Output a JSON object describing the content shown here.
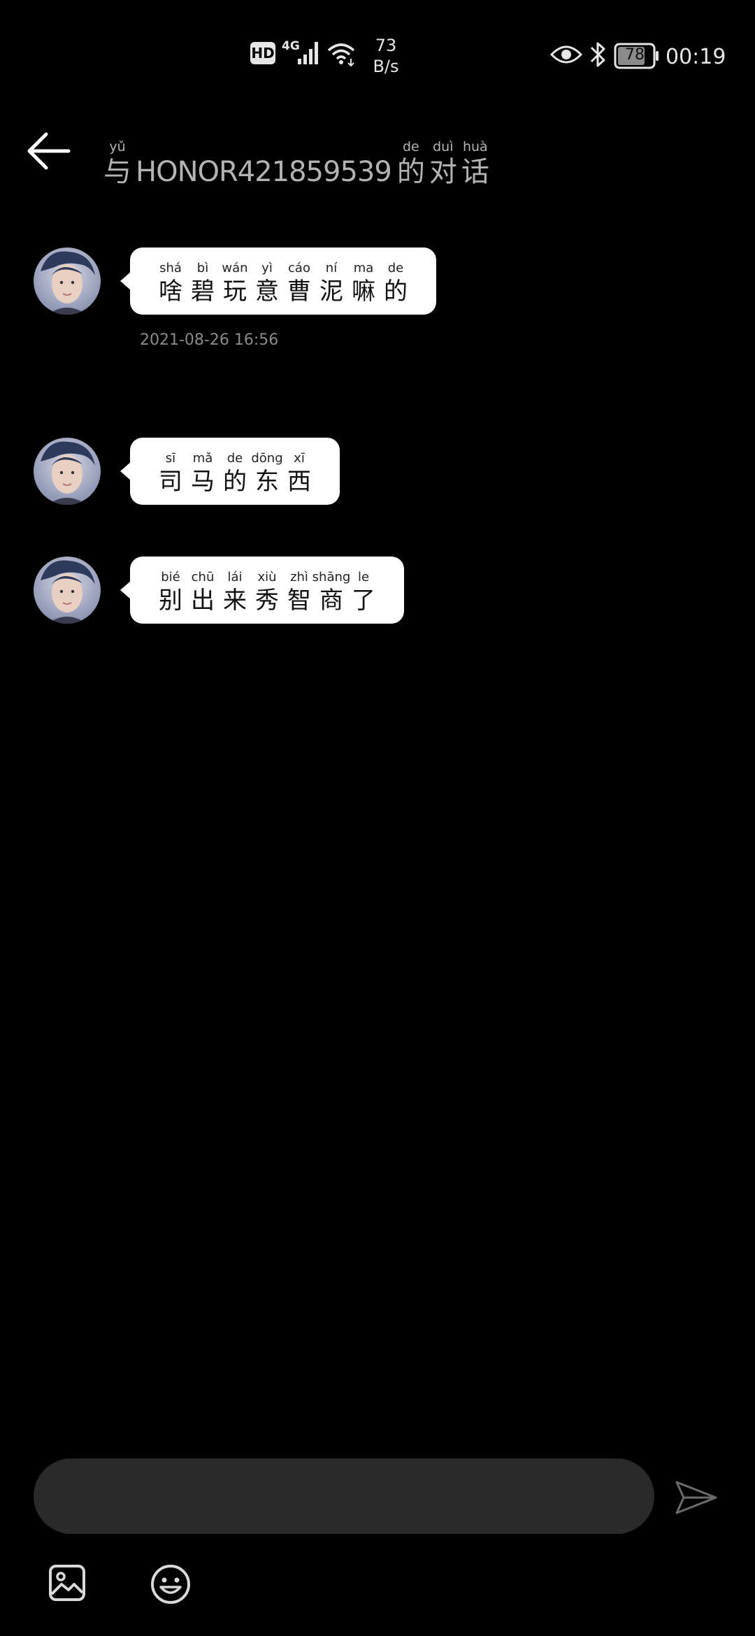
{
  "status_bar": {
    "hd": "HD",
    "network": "4G",
    "speed_value": "73",
    "speed_unit": "B/s",
    "battery": "78",
    "time": "00:19",
    "icons": [
      "signal-icon",
      "wifi-icon",
      "eye-icon",
      "bluetooth-icon",
      "battery-icon"
    ]
  },
  "header": {
    "title_prefix": {
      "py": "yǔ",
      "hz": "与"
    },
    "title_name": "HONOR421859539",
    "title_suffix": [
      {
        "py": "de",
        "hz": "的"
      },
      {
        "py": "duì",
        "hz": "对"
      },
      {
        "py": "huà",
        "hz": "话"
      }
    ]
  },
  "messages": [
    {
      "chars": [
        {
          "py": "shá",
          "hz": "啥"
        },
        {
          "py": "bì",
          "hz": "碧"
        },
        {
          "py": "wán",
          "hz": "玩"
        },
        {
          "py": "yì",
          "hz": "意"
        },
        {
          "py": "cáo",
          "hz": "曹"
        },
        {
          "py": "ní",
          "hz": "泥"
        },
        {
          "py": "ma",
          "hz": "嘛"
        },
        {
          "py": "de",
          "hz": "的"
        }
      ],
      "timestamp": "2021-08-26  16:56"
    },
    {
      "chars": [
        {
          "py": "sī",
          "hz": "司"
        },
        {
          "py": "mǎ",
          "hz": "马"
        },
        {
          "py": "de",
          "hz": "的"
        },
        {
          "py": "dōng",
          "hz": "东"
        },
        {
          "py": "xī",
          "hz": "西"
        }
      ]
    },
    {
      "chars": [
        {
          "py": "bié",
          "hz": "别"
        },
        {
          "py": "chū",
          "hz": "出"
        },
        {
          "py": "lái",
          "hz": "来"
        },
        {
          "py": "xiù",
          "hz": "秀"
        },
        {
          "py": "zhì",
          "hz": "智"
        },
        {
          "py": "shāng",
          "hz": "商"
        },
        {
          "py": "le",
          "hz": "了"
        }
      ]
    }
  ],
  "composer": {
    "input_value": "",
    "placeholder": ""
  },
  "colors": {
    "background": "#000000",
    "bubble": "#ffffff",
    "input": "#2a2a2a",
    "muted_text": "#8a8a8a"
  }
}
